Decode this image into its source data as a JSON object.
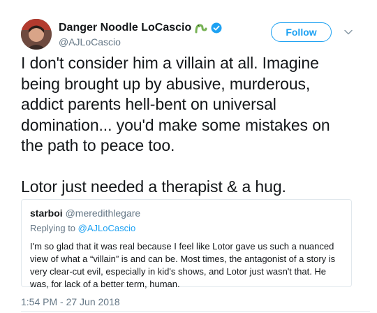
{
  "author": {
    "display_name": "Danger Noodle LoCascio",
    "handle": "@AJLoCascio",
    "emoji_icon": "snake-icon",
    "verified_icon": "verified-badge-icon"
  },
  "follow_button": {
    "label": "Follow"
  },
  "menu_icon": "chevron-down-icon",
  "tweet": {
    "text": "I don't consider him a villain at all. Imagine\nbeing brought up by abusive, murderous,\naddict parents hell-bent on universal\ndomination... you'd make some mistakes on\nthe path to peace too.\n\nLotor just needed a therapist & a hug.",
    "timestamp": "1:54 PM - 27 Jun 2018"
  },
  "quoted_tweet": {
    "display_name": "starboi",
    "handle": "@meredithlegare",
    "replying_prefix": "Replying to",
    "replying_to": "@AJLoCascio",
    "text": "I'm so glad that it was real because I feel like Lotor gave us such a nuanced view of what a “villain” is and can be. Most times, the antagonist of a story is very clear-cut evil, especially in kid's shows, and Lotor just wasn't that. He was, for lack of a better term, human."
  },
  "colors": {
    "accent": "#1da1f2",
    "secondary_text": "#657786",
    "primary_text": "#14171a",
    "border": "#e1e8ed",
    "emoji_green": "#77b255"
  }
}
